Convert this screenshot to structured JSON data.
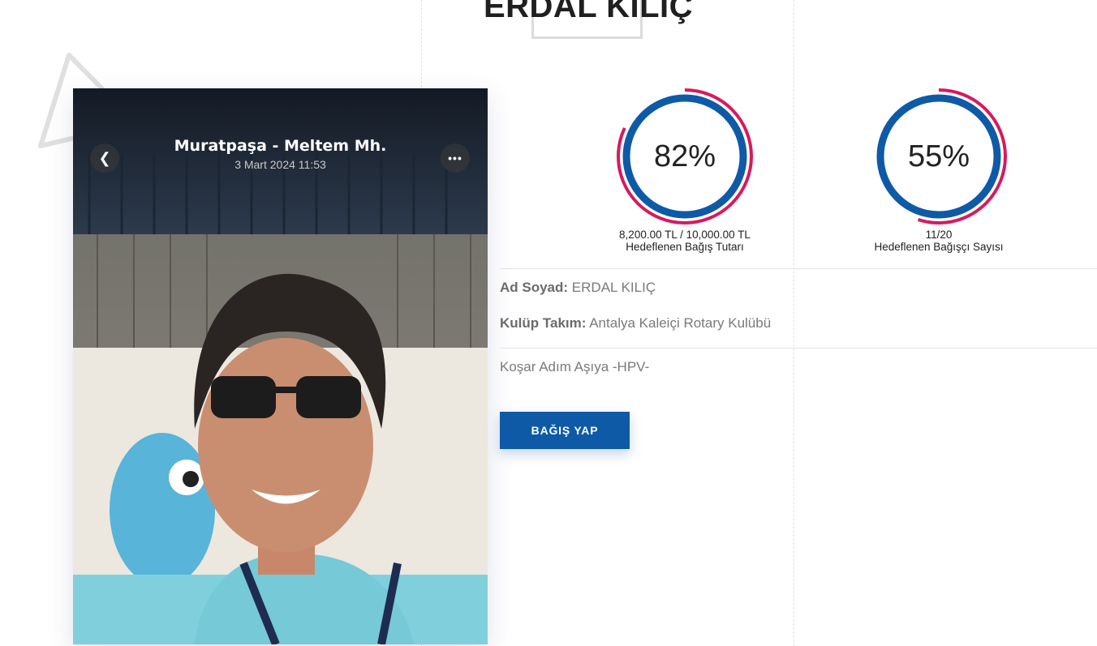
{
  "header": {
    "title": "ERDAL KILIÇ"
  },
  "photo": {
    "place": "Muratpaşa - Meltem Mh.",
    "date": "3 Mart 2024  11:53",
    "back_icon": "chevron-left-icon",
    "more_icon": "more-dots-icon"
  },
  "stats": [
    {
      "percent_text": "82%",
      "progress": 0.82,
      "amount": "8,200.00 TL / 10,000.00 TL",
      "label": "Hedeflenen Bağış Tutarı"
    },
    {
      "percent_text": "55%",
      "progress": 0.55,
      "amount": "11/20",
      "label": "Hedeflenen Bağışçı Sayısı"
    }
  ],
  "details": {
    "name_label": "Ad Soyad:",
    "name_value": "ERDAL KILIÇ",
    "club_label": "Kulüp Takım:",
    "club_value": "Antalya Kaleiçi Rotary Kulübü",
    "description": "Koşar Adım Aşıya -HPV-"
  },
  "donate_button": "BAĞIŞ YAP",
  "colors": {
    "accent": "#0e5aa7",
    "ring_outer": "#d8195e"
  }
}
